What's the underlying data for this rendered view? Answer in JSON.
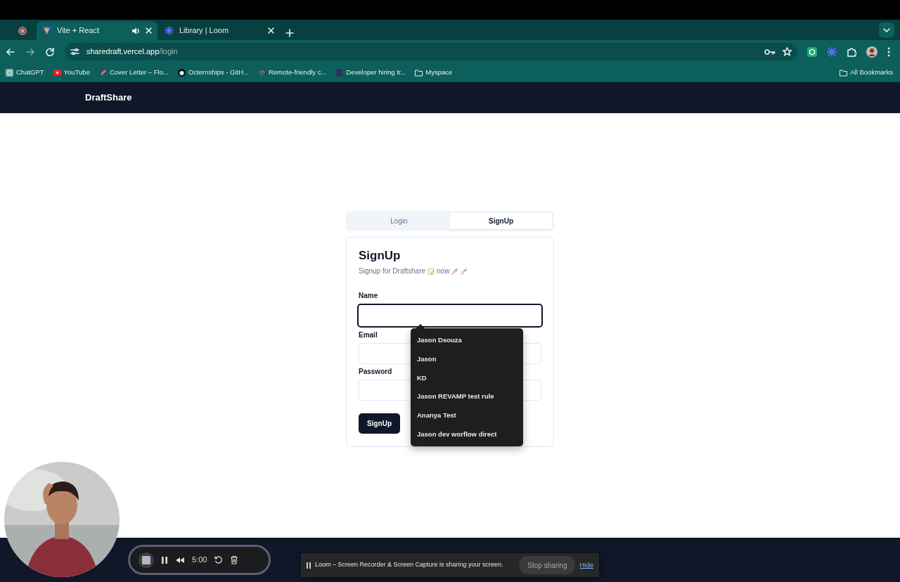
{
  "browser": {
    "tabs": [
      {
        "title": "Vite + React",
        "selected": true,
        "audio": true
      },
      {
        "title": "Library | Loom",
        "selected": false,
        "audio": false
      }
    ],
    "url_host": "sharedraft.vercel.app",
    "url_path": "/login",
    "bookmarks": [
      {
        "label": "ChatGPT",
        "kind": "logo"
      },
      {
        "label": "YouTube",
        "kind": "play"
      },
      {
        "label": "Cover Letter – Flo...",
        "kind": "pen"
      },
      {
        "label": "Octernships - GitH...",
        "kind": "round"
      },
      {
        "label": "Remote-friendly c...",
        "kind": "wifi"
      },
      {
        "label": "Developer hiring tr...",
        "kind": "page"
      },
      {
        "label": "Myspace",
        "kind": "folder"
      }
    ],
    "all_bookmarks": "All Bookmarks"
  },
  "app": {
    "brand": "DraftShare",
    "auth_tabs": [
      {
        "label": "Login",
        "selected": false
      },
      {
        "label": "SignUp",
        "selected": true
      }
    ],
    "title": "SignUp",
    "subtitle": [
      {
        "kind": "text",
        "text": "Signup for Draftshare"
      },
      {
        "kind": "memo"
      },
      {
        "kind": "text",
        "text": "now"
      },
      {
        "kind": "rocket"
      },
      {
        "kind": "rocket"
      }
    ],
    "fields": [
      {
        "label": "Name",
        "focused": true
      },
      {
        "label": "Email",
        "focused": false
      },
      {
        "label": "Password",
        "focused": false
      }
    ],
    "submit": "SignUp"
  },
  "autocomplete": [
    "Jason Dsouza",
    "Jason",
    "KD",
    "Jason REVAMP test rule",
    "Ananya Test",
    "Jason dev worflow direct"
  ],
  "recorder": {
    "time": "5:00"
  },
  "share_banner": {
    "message": "Loom – Screen Recorder & Screen Capture is sharing your screen.",
    "stop": "Stop sharing",
    "hide": "Hide"
  }
}
